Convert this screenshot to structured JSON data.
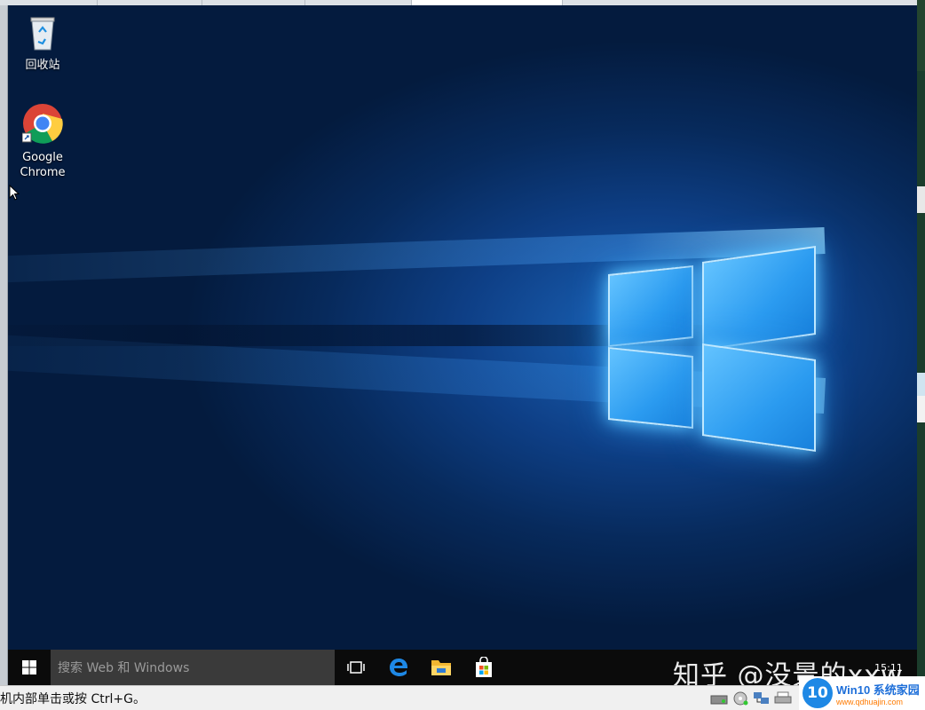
{
  "desktop": {
    "icons": [
      {
        "label": "回收站",
        "icon": "recycle-bin-icon"
      },
      {
        "label": "Google Chrome",
        "icon": "chrome-icon"
      }
    ]
  },
  "taskbar": {
    "search_placeholder": "搜索 Web 和 Windows",
    "pinned": [
      "task-view-icon",
      "edge-icon",
      "file-explorer-icon",
      "store-icon"
    ],
    "clock_time": "15:11"
  },
  "watermark": "知乎 @没景的xxw",
  "statusbar": {
    "hint": "机内部单击或按 Ctrl+G。"
  },
  "site_badge": {
    "number": "10",
    "title": "Win10 系统家园",
    "url": "www.qdhuajin.com"
  },
  "colors": {
    "taskbar": "#0b0b0b",
    "search_bg": "#3a3a3a",
    "desktop_accent": "#2b9bf0"
  }
}
